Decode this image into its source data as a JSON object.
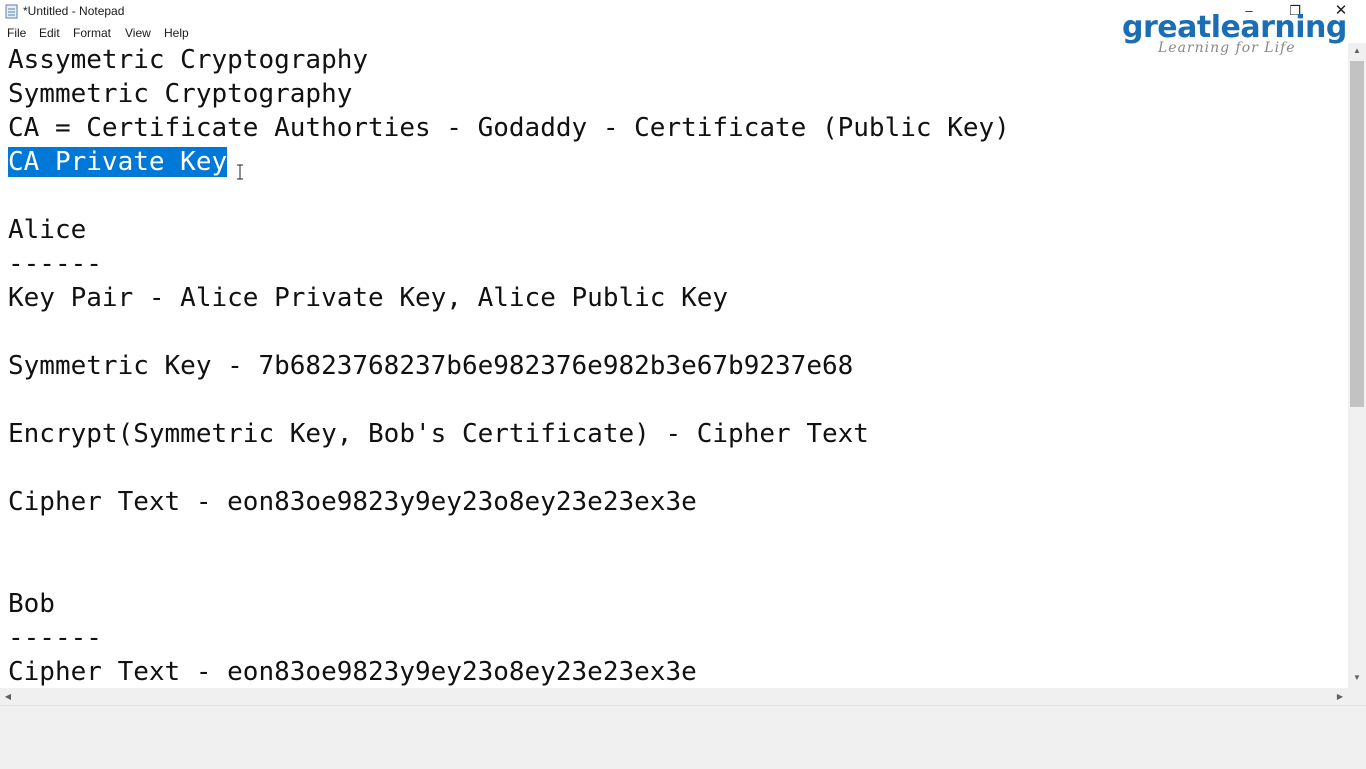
{
  "window": {
    "title": "*Untitled - Notepad",
    "controls": {
      "minimize": "–",
      "maximize": "❐",
      "close": "✕"
    }
  },
  "menu": [
    "File",
    "Edit",
    "Format",
    "View",
    "Help"
  ],
  "logo": {
    "main": "greatlearning",
    "tagline": "Learning for Life",
    "color": "#1b6db4"
  },
  "editor": {
    "lines": [
      "Assymetric Cryptography",
      "Symmetric Cryptography",
      "CA = Certificate Authorties - Godaddy - Certificate (Public Key)",
      "CA Private Key",
      "",
      "Alice",
      "------",
      "Key Pair - Alice Private Key, Alice Public Key",
      "",
      "Symmetric Key - 7b6823768237b6e982376e982b3e67b9237e68",
      "",
      "Encrypt(Symmetric Key, Bob's Certificate) - Cipher Text",
      "",
      "Cipher Text - eon83oe9823y9ey23o8ey23e23ex3e",
      "",
      "",
      "Bob",
      "------",
      "Cipher Text - eon83oe9823y9ey23o8ey23e23ex3e"
    ],
    "selection_color": "#0078d7"
  },
  "icons": {
    "app": "notepad-icon",
    "cursor": "text-cursor-icon",
    "scroll_up": "scroll-up-arrow-icon",
    "scroll_down": "scroll-down-arrow-icon",
    "scroll_left": "scroll-left-arrow-icon",
    "scroll_right": "scroll-right-arrow-icon"
  }
}
